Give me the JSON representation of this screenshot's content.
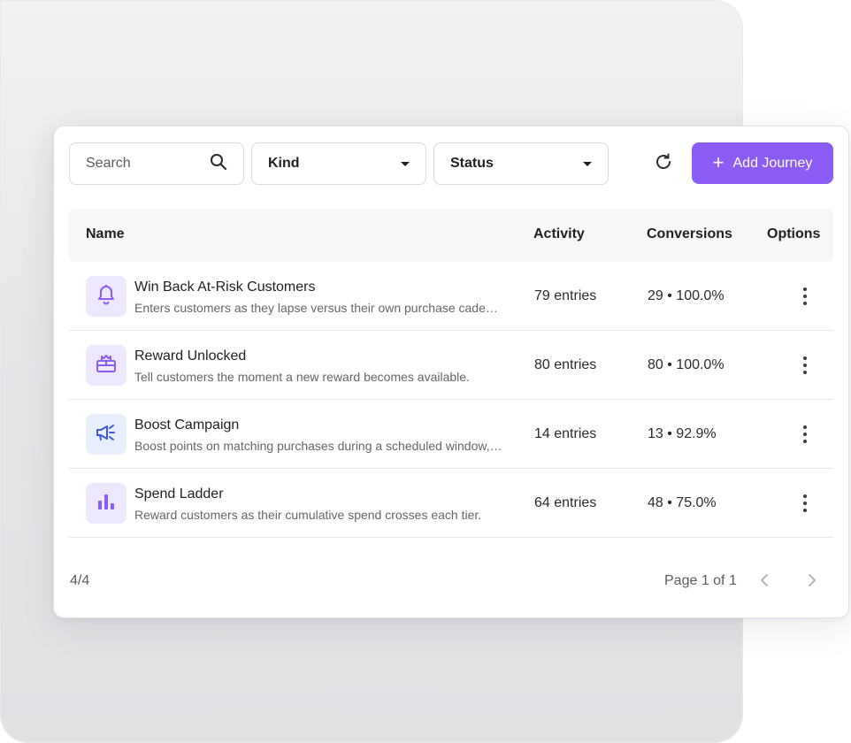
{
  "toolbar": {
    "search_placeholder": "Search",
    "kind_label": "Kind",
    "status_label": "Status",
    "add_label": "Add Journey"
  },
  "table": {
    "headers": {
      "name": "Name",
      "activity": "Activity",
      "conversions": "Conversions",
      "options": "Options"
    },
    "rows": [
      {
        "icon": "bell-icon",
        "title": "Win Back At-Risk Customers",
        "desc": "Enters customers as they lapse versus their own purchase cadence.",
        "activity": "79 entries",
        "conversions": "29 • 100.0%"
      },
      {
        "icon": "gift-icon",
        "title": "Reward Unlocked",
        "desc": "Tell customers the moment a new reward becomes available.",
        "activity": "80 entries",
        "conversions": "80 • 100.0%"
      },
      {
        "icon": "megaphone-icon",
        "title": "Boost Campaign",
        "desc": "Boost points on matching purchases during a scheduled window, for a limited time.",
        "activity": "14 entries",
        "conversions": "13 • 92.9%"
      },
      {
        "icon": "bar-chart-icon",
        "title": "Spend Ladder",
        "desc": "Reward customers as their cumulative spend crosses each tier.",
        "activity": "64 entries",
        "conversions": "48 • 75.0%"
      }
    ]
  },
  "footer": {
    "count": "4/4",
    "page": "Page 1 of 1"
  },
  "colors": {
    "accent": "#8b5cf6",
    "icon_bg": "#ede8fd",
    "icon_alt_bg": "#e8eefc"
  }
}
